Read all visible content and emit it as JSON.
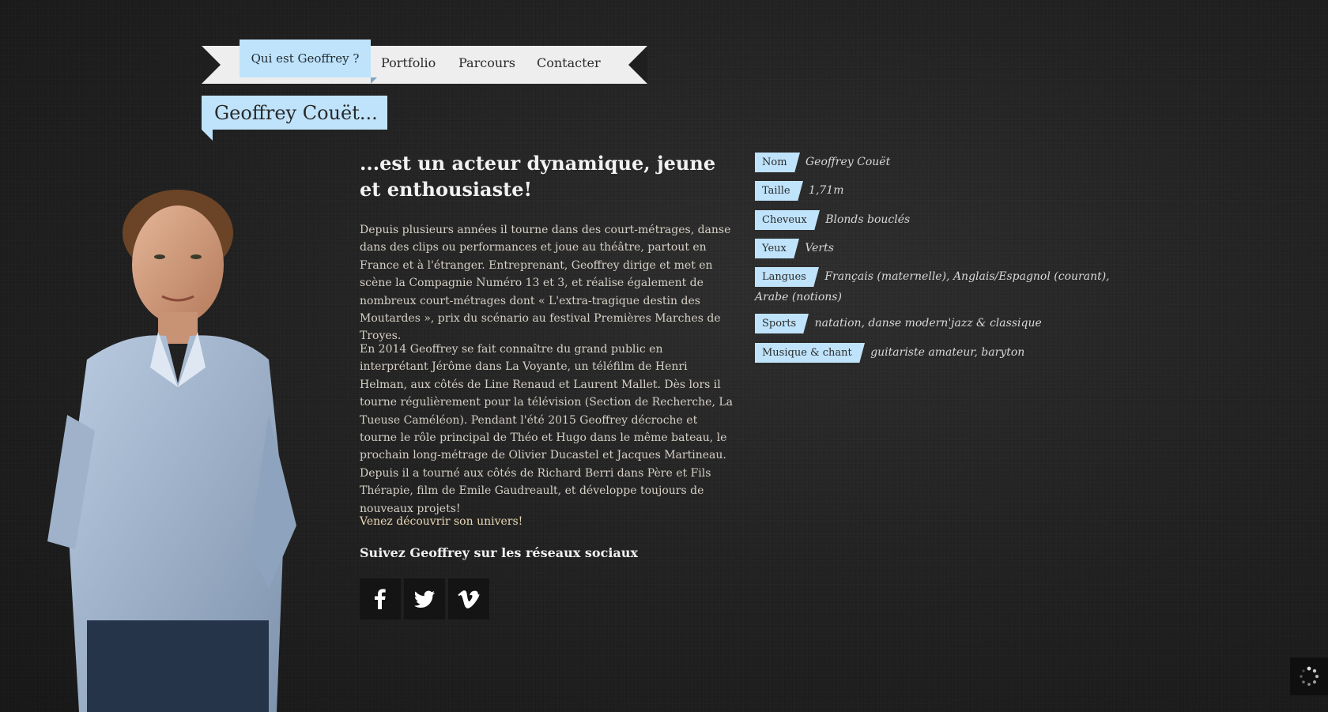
{
  "nav": {
    "items": [
      {
        "label": "Qui est Geoffrey ?"
      },
      {
        "label": "Portfolio"
      },
      {
        "label": "Parcours"
      },
      {
        "label": "Contacter"
      }
    ]
  },
  "title": "Geoffrey Couët...",
  "main": {
    "headline": "...est un acteur dynamique, jeune et enthousiaste!",
    "paragraph1": "Depuis plusieurs années il tourne dans des court-métrages, danse dans des clips ou performances et joue au théâtre, partout en France et à l'étranger. Entreprenant, Geoffrey dirige et met en scène la Compagnie Numéro 13 et 3, et réalise également de nombreux court-métrages dont « L'extra-tragique destin des Moutardes », prix du scénario au festival Premières Marches de Troyes.",
    "paragraph2": "En 2014 Geoffrey se fait connaître du grand public en interprétant Jérôme dans La Voyante, un téléfilm de Henri Helman, aux côtés de Line Renaud et Laurent Mallet. Dès lors il tourne régulièrement pour la télévision (Section de Recherche, La Tueuse Caméléon). Pendant l'été 2015 Geoffrey décroche et tourne le rôle principal de Théo et Hugo dans le même bateau, le prochain long-métrage de Olivier Ducastel et Jacques Martineau. Depuis il a tourné aux côtés de Richard Berri dans Père et Fils Thérapie, film de Emile Gaudreault, et développe toujours de nouveaux projets!",
    "paragraph3": "Venez découvrir son univers!",
    "follow": "Suivez Geoffrey sur les réseaux sociaux"
  },
  "social": [
    {
      "icon": "facebook-icon"
    },
    {
      "icon": "twitter-icon"
    },
    {
      "icon": "vimeo-icon"
    }
  ],
  "info": [
    {
      "label": "Nom",
      "value": "Geoffrey Couët"
    },
    {
      "label": "Taille",
      "value": "1,71m"
    },
    {
      "label": "Cheveux",
      "value": "Blonds bouclés"
    },
    {
      "label": "Yeux",
      "value": "Verts"
    },
    {
      "label": "Langues",
      "value": "Français (maternelle), Anglais/Espagnol (courant), Arabe (notions)"
    },
    {
      "label": "Sports",
      "value": "natation, danse modern'jazz & classique"
    },
    {
      "label": "Musique & chant",
      "value": "guitariste amateur, baryton"
    }
  ],
  "colors": {
    "accent": "#bfe3fb",
    "background": "#222222"
  }
}
